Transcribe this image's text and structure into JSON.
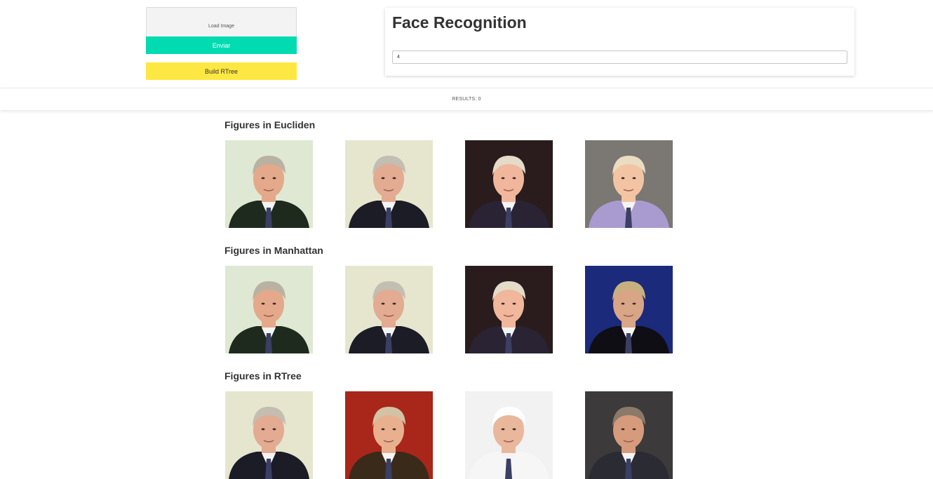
{
  "controls": {
    "load_image_label": "Load Image",
    "submit_label": "Enviar",
    "build_rtree_label": "Build RTree"
  },
  "card": {
    "title": "Face Recognition",
    "k_value": "4"
  },
  "results": {
    "label": "RESULTS: 0"
  },
  "sections": [
    {
      "title": "Figures in Eucliden",
      "images": [
        {
          "icon": "face-photo",
          "bg": "#dfe8d2",
          "suit": "#1e2a1e",
          "hair": "#b9b2a3",
          "skin": "#e4a98a"
        },
        {
          "icon": "face-photo",
          "bg": "#e6e6cf",
          "suit": "#1c1c26",
          "hair": "#c3bdb2",
          "skin": "#e2ab92"
        },
        {
          "icon": "face-photo",
          "bg": "#2a1c1c",
          "suit": "#2a2333",
          "hair": "#e4dbc9",
          "skin": "#f0b79c"
        },
        {
          "icon": "face-photo",
          "bg": "#7b7772",
          "suit": "#a99bd0",
          "hair": "#e9dcc1",
          "skin": "#f3c4a4"
        }
      ]
    },
    {
      "title": "Figures in Manhattan",
      "images": [
        {
          "icon": "face-photo",
          "bg": "#dfe8d2",
          "suit": "#1e2a1e",
          "hair": "#b9b2a3",
          "skin": "#e4a98a"
        },
        {
          "icon": "face-photo",
          "bg": "#e6e6cf",
          "suit": "#1c1c26",
          "hair": "#c3bdb2",
          "skin": "#e2ab92"
        },
        {
          "icon": "face-photo",
          "bg": "#2a1c1c",
          "suit": "#2a2333",
          "hair": "#e4dbc9",
          "skin": "#f0b79c"
        },
        {
          "icon": "face-photo",
          "bg": "#1b2a7a",
          "suit": "#0e0e14",
          "hair": "#c7b07f",
          "skin": "#d9a587"
        }
      ]
    },
    {
      "title": "Figures in RTree",
      "images": [
        {
          "icon": "face-photo",
          "bg": "#e6e6cf",
          "suit": "#1c1c26",
          "hair": "#c3bdb2",
          "skin": "#e2ab92"
        },
        {
          "icon": "face-photo",
          "bg": "#a8261a",
          "suit": "#3a2a1a",
          "hair": "#d2c3a5",
          "skin": "#e8b08f"
        },
        {
          "icon": "face-photo",
          "bg": "#f2f2f2",
          "suit": "#f6f6f6",
          "hair": "#ffffff",
          "skin": "#e9b79c"
        },
        {
          "icon": "face-photo",
          "bg": "#3c3a3a",
          "suit": "#2b2b33",
          "hair": "#8b7a6a",
          "skin": "#d69b7c"
        }
      ]
    }
  ]
}
